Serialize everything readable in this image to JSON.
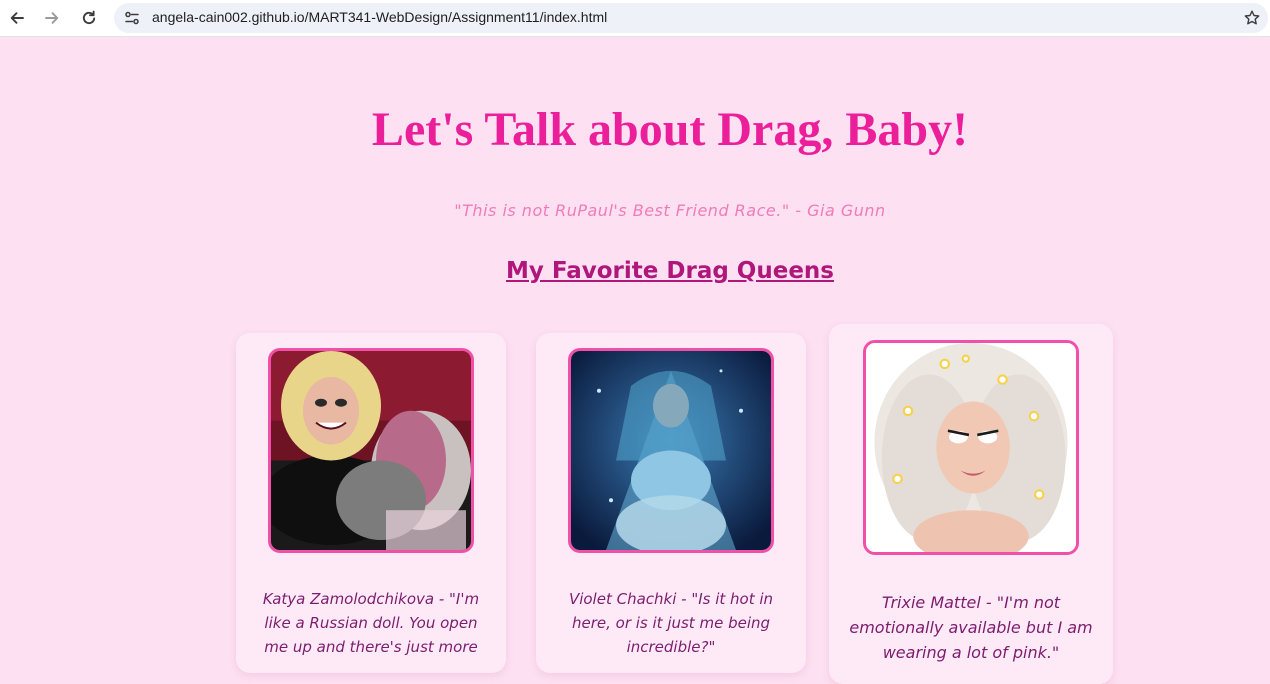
{
  "browser": {
    "url": "angela-cain002.github.io/MART341-WebDesign/Assignment11/index.html"
  },
  "page": {
    "title": "Let's Talk about Drag, Baby!",
    "quote": "\"This is not RuPaul's Best Friend Race.\" - Gia Gunn",
    "section_heading": "My Favorite Drag Queens"
  },
  "queens": [
    {
      "image_subject": "Katya Zamolodchikova photo",
      "caption": "Katya Zamolodchikova - \"I'm like a Russian doll. You open me up and there's just more"
    },
    {
      "image_subject": "Violet Chachki photo",
      "caption": "Violet Chachki - \"Is it hot in here, or is it just me being incredible?\""
    },
    {
      "image_subject": "Trixie Mattel photo",
      "caption": "Trixie Mattel - \"I'm not emotionally available but I am wearing a lot of pink.\""
    }
  ],
  "icons": {
    "back": "arrow-left-icon",
    "forward": "arrow-right-icon",
    "reload": "reload-icon",
    "site_info": "tune-icon",
    "bookmark": "star-icon"
  },
  "colors": {
    "page_background": "#fde0f2",
    "title": "#ec1f9a",
    "quote": "#ef7cb8",
    "section_heading": "#b0177a",
    "card": "#feeaf6",
    "photo_border": "#f150a8",
    "caption": "#7c1d6f"
  }
}
